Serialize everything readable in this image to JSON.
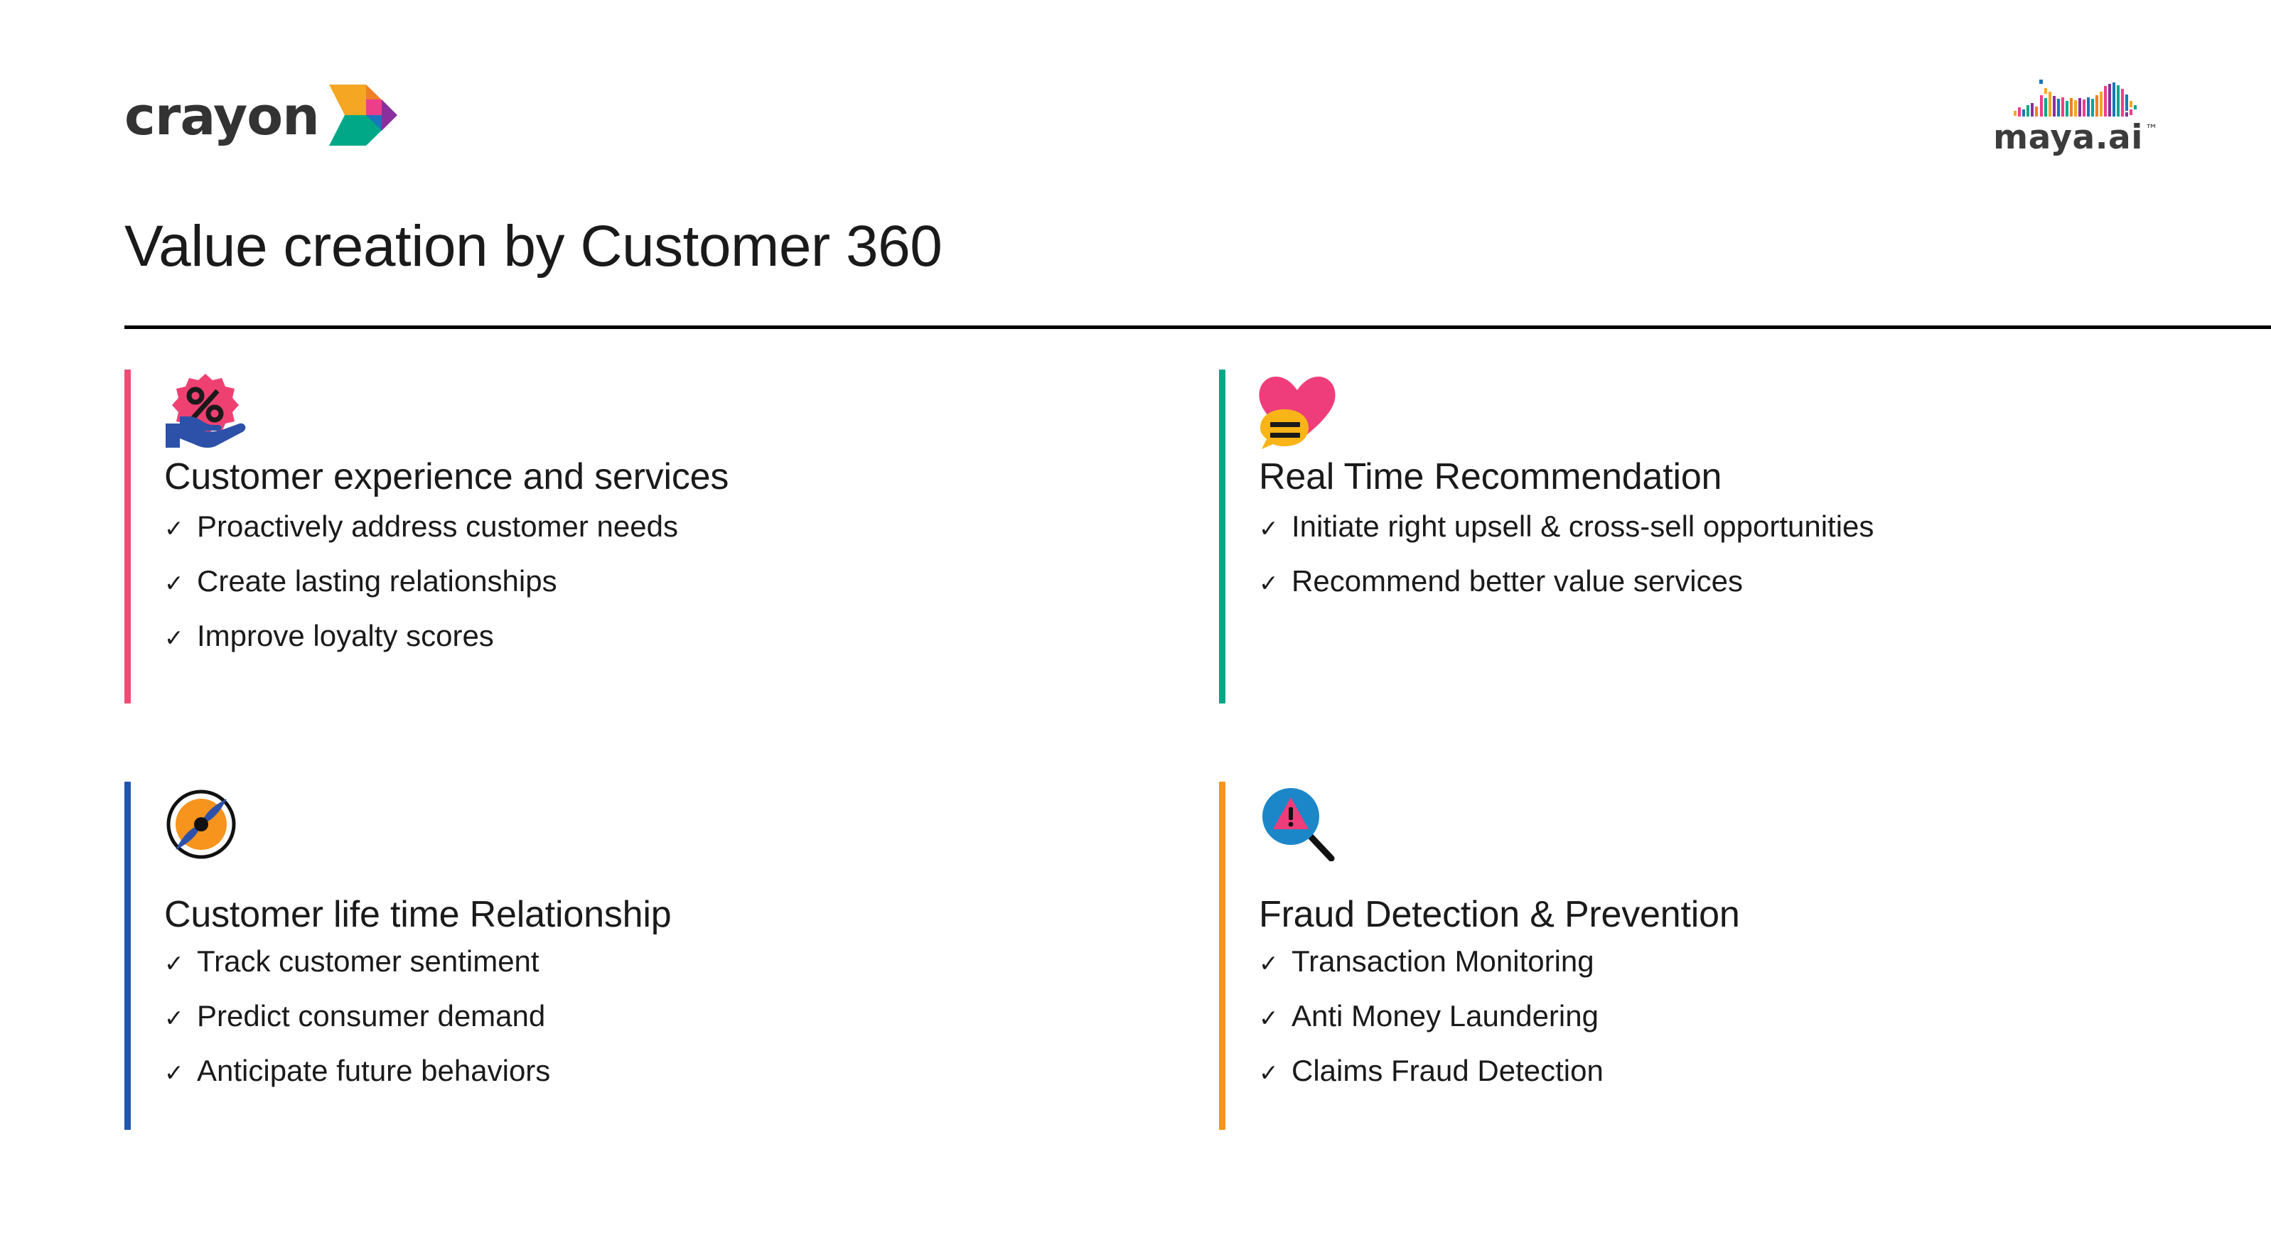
{
  "slide": {
    "title": "Value creation by Customer 360",
    "background": "#FFFFFF",
    "rule_color": "#000000"
  },
  "brand": {
    "crayon": {
      "wordmark": "crayon",
      "icon": "crayon-arrow-logo",
      "arrow_colors": [
        "#F5A623",
        "#F07E26",
        "#EE3D8B",
        "#8B2F9E",
        "#00A887",
        "#1B75BC"
      ],
      "text_color": "#333333"
    },
    "maya": {
      "wordmark": "maya.ai",
      "trademark": "™",
      "icon": "maya-waveform-logo",
      "text_color": "#3C3C3C"
    }
  },
  "cards": [
    {
      "id": "customer-experience-and-services",
      "heading": "Customer experience and services",
      "accent_color": "#EE4C77",
      "icon": "discount-in-hand-icon",
      "bullets": [
        "Proactively address customer needs",
        "Create lasting relationships",
        "Improve loyalty scores"
      ]
    },
    {
      "id": "real-time-recommendation",
      "heading": "Real Time Recommendation",
      "accent_color": "#00A887",
      "icon": "heart-chat-bubble-icon",
      "bullets": [
        "Initiate right upsell & cross-sell opportunities",
        "Recommend better value services"
      ]
    },
    {
      "id": "customer-life-time-relationship",
      "heading": "Customer life time Relationship",
      "accent_color": "#2256AD",
      "icon": "compass-icon",
      "bullets": [
        "Track customer sentiment",
        "Predict consumer demand",
        "Anticipate future behaviors"
      ]
    },
    {
      "id": "fraud-detection-and-prevention",
      "heading": "Fraud Detection & Prevention",
      "accent_color": "#F7941E",
      "icon": "magnifier-warning-icon",
      "bullets": [
        "Transaction Monitoring",
        "Anti Money Laundering",
        "Claims Fraud Detection"
      ]
    }
  ],
  "bullet_marker": "✓"
}
